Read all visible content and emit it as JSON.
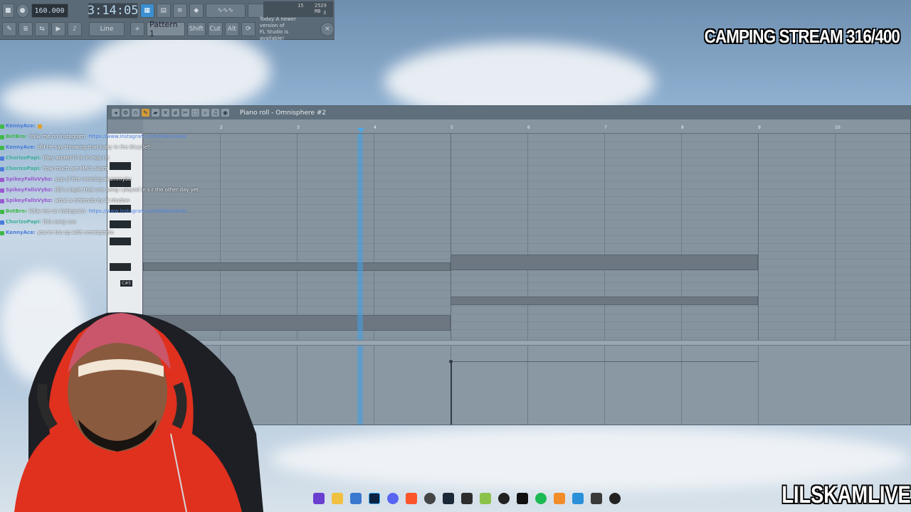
{
  "toolbar": {
    "bpm": "160.000",
    "time": "3:14:05",
    "snap": "Line",
    "pattern": "Pattern 1",
    "buttons": [
      "Shift",
      "Cut",
      "Alt"
    ],
    "update_hint_line1": "Today   A newer version of",
    "update_hint_line2": "FL Studio is available!",
    "cpu_value": "15",
    "mem_value": "2529 MB",
    "polyphony": "3"
  },
  "overlay": {
    "title": "CAMPING STREAM 316/400",
    "brand": "LILSKAMLIVE"
  },
  "piano_roll": {
    "title": "Piano roll - Omnisphere #2",
    "bar_numbers": [
      "2",
      "3",
      "4",
      "5",
      "6",
      "7",
      "8",
      "9",
      "10"
    ],
    "key_label": "C#5"
  },
  "chat": [
    {
      "user": "KennyAce:",
      "color": "#4a7cd9",
      "msg": "",
      "link": ""
    },
    {
      "user": "BotBro:",
      "color": "#3fb84a",
      "msg": "follw me on instagram:",
      "link": "https://www.instagram.com/lilskamlive/"
    },
    {
      "user": "KennyAce:",
      "color": "#4a7cd9",
      "msg": "did he say throwing that baby in the Bicycle?",
      "link": ""
    },
    {
      "user": "ChorizoPapi:",
      "color": "#3fae9a",
      "msg": "they added fl on fn hop on",
      "link": ""
    },
    {
      "user": "ChorizoPapi:",
      "color": "#3fae9a",
      "msg": "how much are Mel's skam",
      "link": ""
    },
    {
      "user": "SpikeyFallsVybz:",
      "color": "#9b59d0",
      "msg": "yop of the morning scammybo",
      "link": ""
    },
    {
      "user": "SpikeyFallsVybz:",
      "color": "#9b59d0",
      "msg": "did u sapie that one song i played in s r the other day yet",
      "link": ""
    },
    {
      "user": "SpikeyFallsVybz:",
      "color": "#9b59d0",
      "msg": "what a nintendo by lil shadow",
      "link": ""
    },
    {
      "user": "BotBro:",
      "color": "#3fb84a",
      "msg": "follw me on instagram:",
      "link": "https://www.instagram.com/lilskamlive/"
    },
    {
      "user": "ChorizoPapi:",
      "color": "#3fae9a",
      "msg": "this song coo",
      "link": ""
    },
    {
      "user": "KennyAce:",
      "color": "#4a7cd9",
      "msg": "you're too op with omnisphere",
      "link": ""
    }
  ],
  "taskbar_icons": [
    "photos-icon",
    "folder-icon",
    "store-icon",
    "photoshop-icon",
    "discord-icon",
    "brave-icon",
    "chrome-icon",
    "steam-icon",
    "app-icon",
    "app2-icon",
    "capcut-icon",
    "spotify-icon",
    "fl-studio-icon",
    "app3-icon",
    "notes-icon",
    "obs-icon"
  ],
  "colors": {
    "playhead": "#4aa8e8",
    "overlay_text": "#ffffff",
    "hoodie": "#e0301e"
  }
}
